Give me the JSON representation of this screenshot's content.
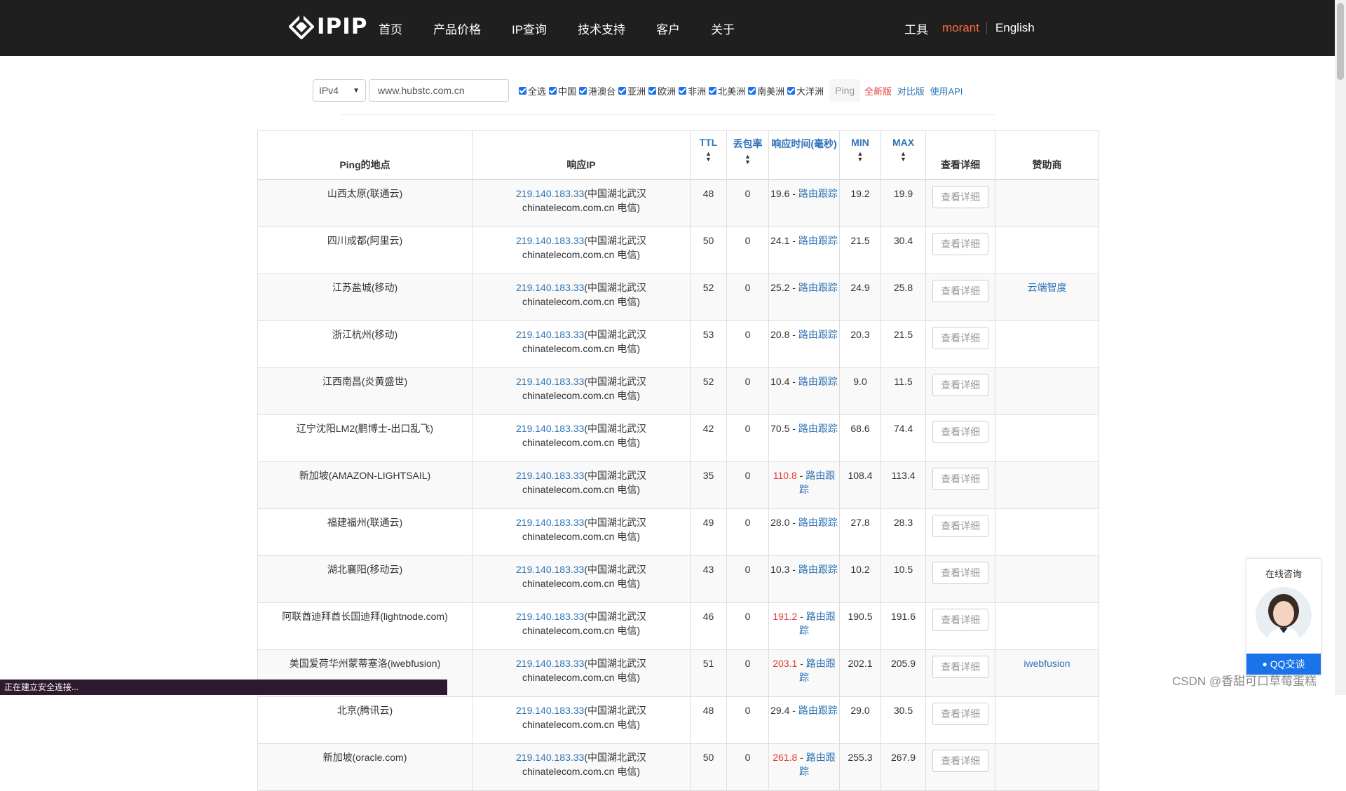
{
  "nav": {
    "logo_text": "IPIP",
    "items": [
      "首页",
      "产品价格",
      "IP查询",
      "技术支持",
      "客户",
      "关于"
    ],
    "tools": "工具",
    "user": "morant",
    "lang": "English"
  },
  "search": {
    "protocol": "IPv4",
    "host": "www.hubstc.com.cn",
    "regions": [
      "全选",
      "中国",
      "港澳台",
      "亚洲",
      "欧洲",
      "非洲",
      "北美洲",
      "南美洲",
      "大洋洲"
    ],
    "ping_button": "Ping",
    "new_version": "全新版",
    "compare": "对比版",
    "use_api": "使用API"
  },
  "table": {
    "headers": {
      "location": "Ping的地点",
      "ip": "响应IP",
      "ttl": "TTL",
      "loss": "丢包率",
      "time": "响应时间(毫秒)",
      "min": "MIN",
      "max": "MAX",
      "detail": "查看详细",
      "sponsor": "赞助商"
    },
    "trace_label": "路由跟踪",
    "detail_label": "查看详细",
    "rows": [
      {
        "location": "山西太原(联通云)",
        "ip": "219.140.183.33",
        "ip_info": "(中国湖北武汉",
        "ip_host": "chinatelecom.com.cn 电信)",
        "ttl": "48",
        "loss": "0",
        "time": "19.6",
        "time_red": false,
        "min": "19.2",
        "max": "19.9",
        "sponsor": ""
      },
      {
        "location": "四川成都(阿里云)",
        "ip": "219.140.183.33",
        "ip_info": "(中国湖北武汉",
        "ip_host": "chinatelecom.com.cn 电信)",
        "ttl": "50",
        "loss": "0",
        "time": "24.1",
        "time_red": false,
        "min": "21.5",
        "max": "30.4",
        "sponsor": ""
      },
      {
        "location": "江苏盐城(移动)",
        "ip": "219.140.183.33",
        "ip_info": "(中国湖北武汉",
        "ip_host": "chinatelecom.com.cn 电信)",
        "ttl": "52",
        "loss": "0",
        "time": "25.2",
        "time_red": false,
        "min": "24.9",
        "max": "25.8",
        "sponsor": "云端智度"
      },
      {
        "location": "浙江杭州(移动)",
        "ip": "219.140.183.33",
        "ip_info": "(中国湖北武汉",
        "ip_host": "chinatelecom.com.cn 电信)",
        "ttl": "53",
        "loss": "0",
        "time": "20.8",
        "time_red": false,
        "min": "20.3",
        "max": "21.5",
        "sponsor": ""
      },
      {
        "location": "江西南昌(炎黄盛世)",
        "ip": "219.140.183.33",
        "ip_info": "(中国湖北武汉",
        "ip_host": "chinatelecom.com.cn 电信)",
        "ttl": "52",
        "loss": "0",
        "time": "10.4",
        "time_red": false,
        "min": "9.0",
        "max": "11.5",
        "sponsor": ""
      },
      {
        "location": "辽宁沈阳LM2(鹏博士-出口乱飞)",
        "ip": "219.140.183.33",
        "ip_info": "(中国湖北武汉",
        "ip_host": "chinatelecom.com.cn 电信)",
        "ttl": "42",
        "loss": "0",
        "time": "70.5",
        "time_red": false,
        "min": "68.6",
        "max": "74.4",
        "sponsor": ""
      },
      {
        "location": "新加坡(AMAZON-LIGHTSAIL)",
        "ip": "219.140.183.33",
        "ip_info": "(中国湖北武汉",
        "ip_host": "chinatelecom.com.cn 电信)",
        "ttl": "35",
        "loss": "0",
        "time": "110.8",
        "time_red": true,
        "min": "108.4",
        "max": "113.4",
        "sponsor": ""
      },
      {
        "location": "福建福州(联通云)",
        "ip": "219.140.183.33",
        "ip_info": "(中国湖北武汉",
        "ip_host": "chinatelecom.com.cn 电信)",
        "ttl": "49",
        "loss": "0",
        "time": "28.0",
        "time_red": false,
        "min": "27.8",
        "max": "28.3",
        "sponsor": ""
      },
      {
        "location": "湖北襄阳(移动云)",
        "ip": "219.140.183.33",
        "ip_info": "(中国湖北武汉",
        "ip_host": "chinatelecom.com.cn 电信)",
        "ttl": "43",
        "loss": "0",
        "time": "10.3",
        "time_red": false,
        "min": "10.2",
        "max": "10.5",
        "sponsor": ""
      },
      {
        "location": "阿联酋迪拜酋长国迪拜(lightnode.com)",
        "ip": "219.140.183.33",
        "ip_info": "(中国湖北武汉",
        "ip_host": "chinatelecom.com.cn 电信)",
        "ttl": "46",
        "loss": "0",
        "time": "191.2",
        "time_red": true,
        "min": "190.5",
        "max": "191.6",
        "sponsor": ""
      },
      {
        "location": "美国爱荷华州蒙蒂塞洛(iwebfusion)",
        "ip": "219.140.183.33",
        "ip_info": "(中国湖北武汉",
        "ip_host": "chinatelecom.com.cn 电信)",
        "ttl": "51",
        "loss": "0",
        "time": "203.1",
        "time_red": true,
        "min": "202.1",
        "max": "205.9",
        "sponsor": "iwebfusion"
      },
      {
        "location": "北京(腾讯云)",
        "ip": "219.140.183.33",
        "ip_info": "(中国湖北武汉",
        "ip_host": "chinatelecom.com.cn 电信)",
        "ttl": "48",
        "loss": "0",
        "time": "29.4",
        "time_red": false,
        "min": "29.0",
        "max": "30.5",
        "sponsor": ""
      },
      {
        "location": "新加坡(oracle.com)",
        "ip": "219.140.183.33",
        "ip_info": "(中国湖北武汉",
        "ip_host": "chinatelecom.com.cn 电信)",
        "ttl": "50",
        "loss": "0",
        "time": "261.8",
        "time_red": true,
        "min": "255.3",
        "max": "267.9",
        "sponsor": ""
      }
    ]
  },
  "consult": {
    "title": "在线咨询",
    "qq": "QQ交谈"
  },
  "status_bar": "正在建立安全连接...",
  "watermark": "CSDN @香甜可口草莓蛋糕",
  "colors": {
    "nav_bg": "#1f1f1f",
    "accent_user": "#ff6a3d",
    "link": "#2f74b5",
    "warn": "#e53935",
    "qq_blue": "#1a73e8"
  }
}
